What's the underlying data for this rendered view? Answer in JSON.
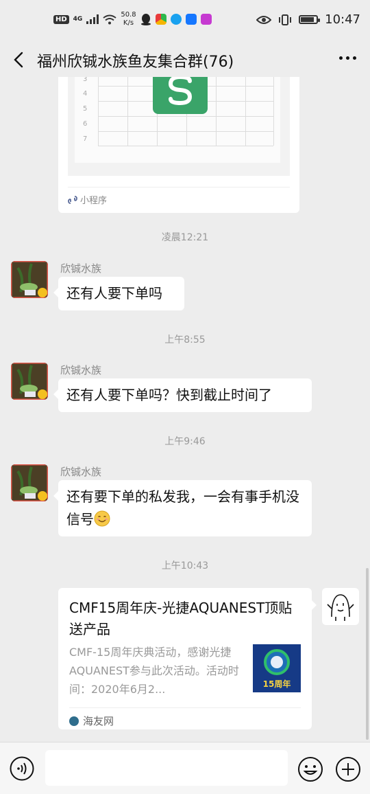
{
  "status_bar": {
    "hd": "HD",
    "network": "4G",
    "net_speed_value": "50.8",
    "net_speed_unit": "K/s",
    "time": "10:47",
    "battery_level": 0.85
  },
  "header": {
    "title": "福州欣铖水族鱼友集合群(76)"
  },
  "chat": {
    "mini_program_card": {
      "row_numbers": [
        "3",
        "4",
        "5",
        "6",
        "7"
      ],
      "footer_label": "小程序"
    },
    "messages": [
      {
        "timestamp": "凌晨12:21",
        "sender": "欣铖水族",
        "text": "还有人要下单吗"
      },
      {
        "timestamp": "上午8:55",
        "sender": "欣铖水族",
        "text": "还有人要下单吗？快到截止时间了"
      },
      {
        "timestamp": "上午9:46",
        "sender": "欣铖水族",
        "text": "还有要下单的私发我，一会有事手机没信号"
      }
    ],
    "link_message": {
      "timestamp": "上午10:43",
      "title": "CMF15周年庆-光捷AQUANEST顶贴送产品",
      "description": "CMF-15周年庆典活动，感谢光捷AQUANEST参与此次活动。活动时间：2020年6月2...",
      "thumb_text": "15周年",
      "source": "海友网"
    }
  },
  "input_bar": {
    "placeholder": ""
  },
  "colors": {
    "background": "#ededed",
    "bubble": "#ffffff",
    "wps_green": "#3aa469",
    "timestamp_gray": "#999999"
  }
}
